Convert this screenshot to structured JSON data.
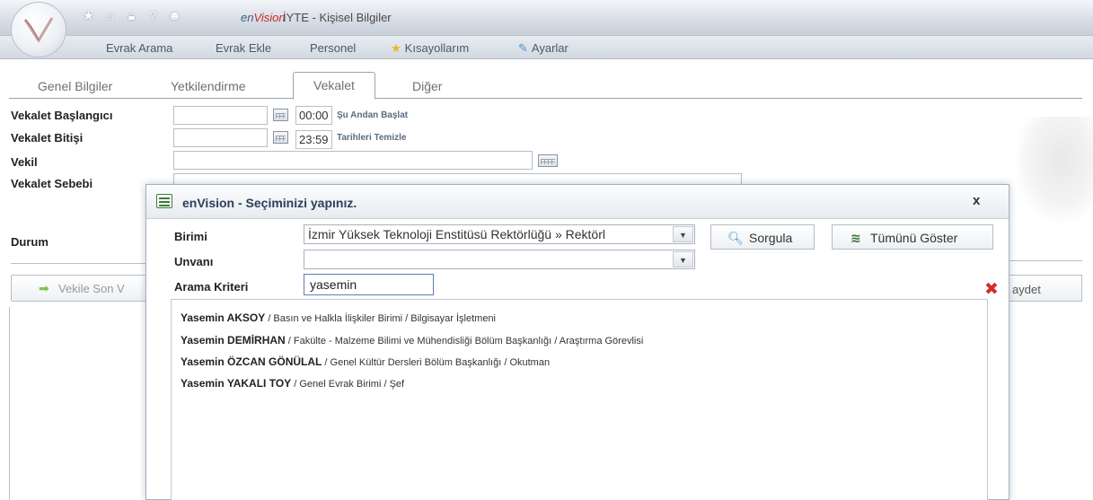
{
  "header": {
    "brand_env": "en",
    "brand_vision": "Vision",
    "title": "İYTE - Kişisel Bilgiler",
    "quick_icons": [
      "star-icon",
      "home-icon",
      "lock-icon",
      "help-icon",
      "users-icon"
    ]
  },
  "menu": {
    "items": [
      {
        "label": "Evrak Arama"
      },
      {
        "label": "Evrak Ekle"
      },
      {
        "label": "Personel"
      },
      {
        "label": "Kısayollarım",
        "icon": "star-icon"
      },
      {
        "label": "Ayarlar",
        "icon": "settings-icon"
      }
    ]
  },
  "tabs": [
    {
      "label": "Genel Bilgiler"
    },
    {
      "label": "Yetkilendirme"
    },
    {
      "label": "Vekalet",
      "active": true
    },
    {
      "label": "Diğer"
    }
  ],
  "form": {
    "start_label": "Vekalet Başlangıcı",
    "start_time": "00:00",
    "start_link": "Şu Andan Başlat",
    "end_label": "Vekalet Bitişi",
    "end_time": "23:59",
    "end_link": "Tarihleri Temizle",
    "vekil_label": "Vekil",
    "reason_label": "Vekalet Sebebi",
    "status_label": "Durum",
    "vekile_button": "Vekile Son V",
    "save_button_fragment": "aydet"
  },
  "dialog": {
    "title": "enVision - Seçiminizi yapınız.",
    "close": "x",
    "birimi_label": "Birimi",
    "birimi_value": "İzmir Yüksek Teknoloji Enstitüsü Rektörlüğü » Rektörl",
    "unvani_label": "Unvanı",
    "unvani_value": "",
    "criteria_label": "Arama Kriteri",
    "criteria_value": "yasemin",
    "search_button": "Sorgula",
    "show_all_button": "Tümünü Göster",
    "results": [
      {
        "name": "Yasemin AKSOY",
        "detail": " / Basın ve Halkla İlişkiler Birimi / Bilgisayar İşletmeni"
      },
      {
        "name": "Yasemin DEMİRHAN",
        "detail": " / Fakülte - Malzeme Bilimi ve Mühendisliği Bölüm Başkanlığı / Araştırma Görevlisi"
      },
      {
        "name": "Yasemin ÖZCAN GÖNÜLAL",
        "detail": " / Genel Kültür Dersleri Bölüm Başkanlığı / Okutman"
      },
      {
        "name": "Yasemin YAKALI TOY",
        "detail": " / Genel Evrak Birimi / Şef"
      }
    ]
  }
}
